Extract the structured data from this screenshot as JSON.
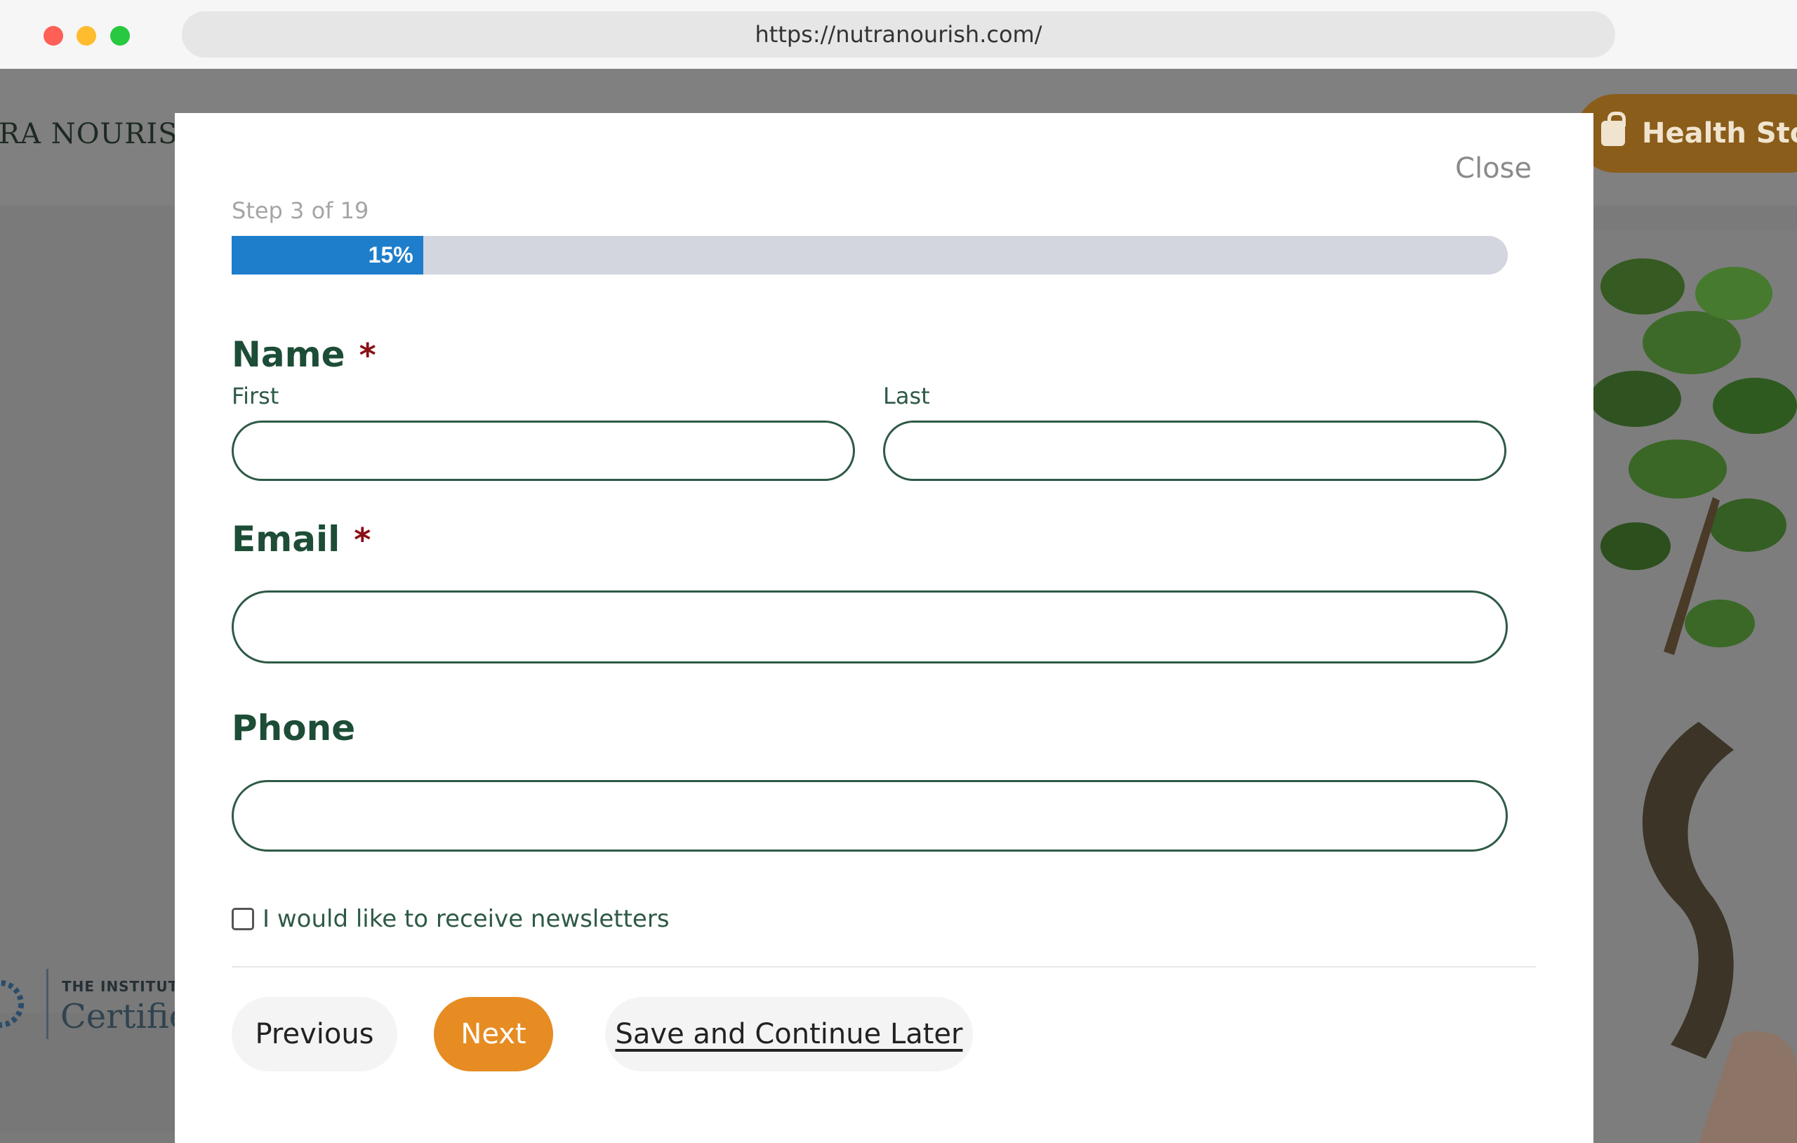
{
  "browser": {
    "url": "https://nutranourish.com/"
  },
  "background_page": {
    "brand_text": "RA NOURISH",
    "store_button_label": "Health Sto",
    "cert_line1": "THE INSTITUTE",
    "cert_line2": "Certifie"
  },
  "modal": {
    "close_label": "Close",
    "step_text": "Step 3 of 19",
    "progress": {
      "percent": 15,
      "label": "15%",
      "color": "#1e7ecb"
    },
    "fields": {
      "name": {
        "label": "Name",
        "required_marker": "*",
        "first_label": "First",
        "last_label": "Last",
        "first_value": "",
        "last_value": ""
      },
      "email": {
        "label": "Email",
        "required_marker": "*",
        "value": ""
      },
      "phone": {
        "label": "Phone",
        "value": ""
      }
    },
    "newsletter": {
      "label": "I would like to receive newsletters",
      "checked": false
    },
    "buttons": {
      "previous": "Previous",
      "next": "Next",
      "save_later": "Save and Continue Later"
    }
  },
  "colors": {
    "accent_orange": "#e68c23",
    "label_green": "#1d4d36",
    "required_red": "#8a0f16"
  }
}
